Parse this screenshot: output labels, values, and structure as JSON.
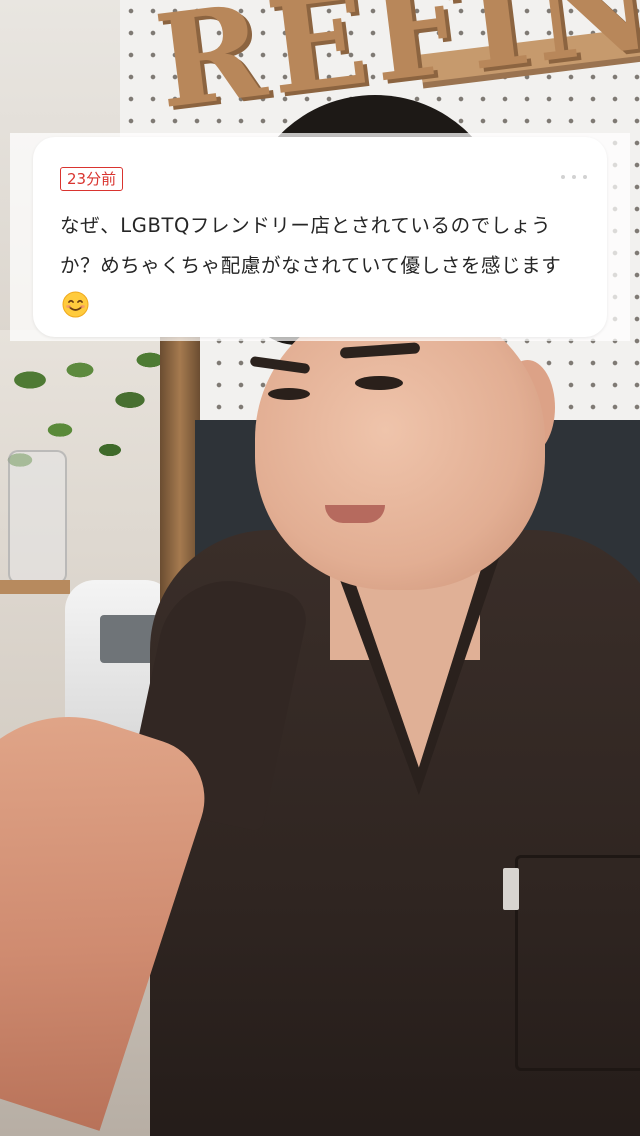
{
  "comment": {
    "time_label": "23分前",
    "text": "なぜ、LGBTQフレンドリー店とされているのでしょうか？めちゃくちゃ配慮がなされていて優しさを感じます",
    "emoji": "smiling-face-icon"
  },
  "background": {
    "sign_text": "REFIN"
  },
  "colors": {
    "badge": "#d9342f",
    "card": "#ffffff",
    "comment_text": "#262626",
    "scrub_top": "#3a2e29"
  }
}
